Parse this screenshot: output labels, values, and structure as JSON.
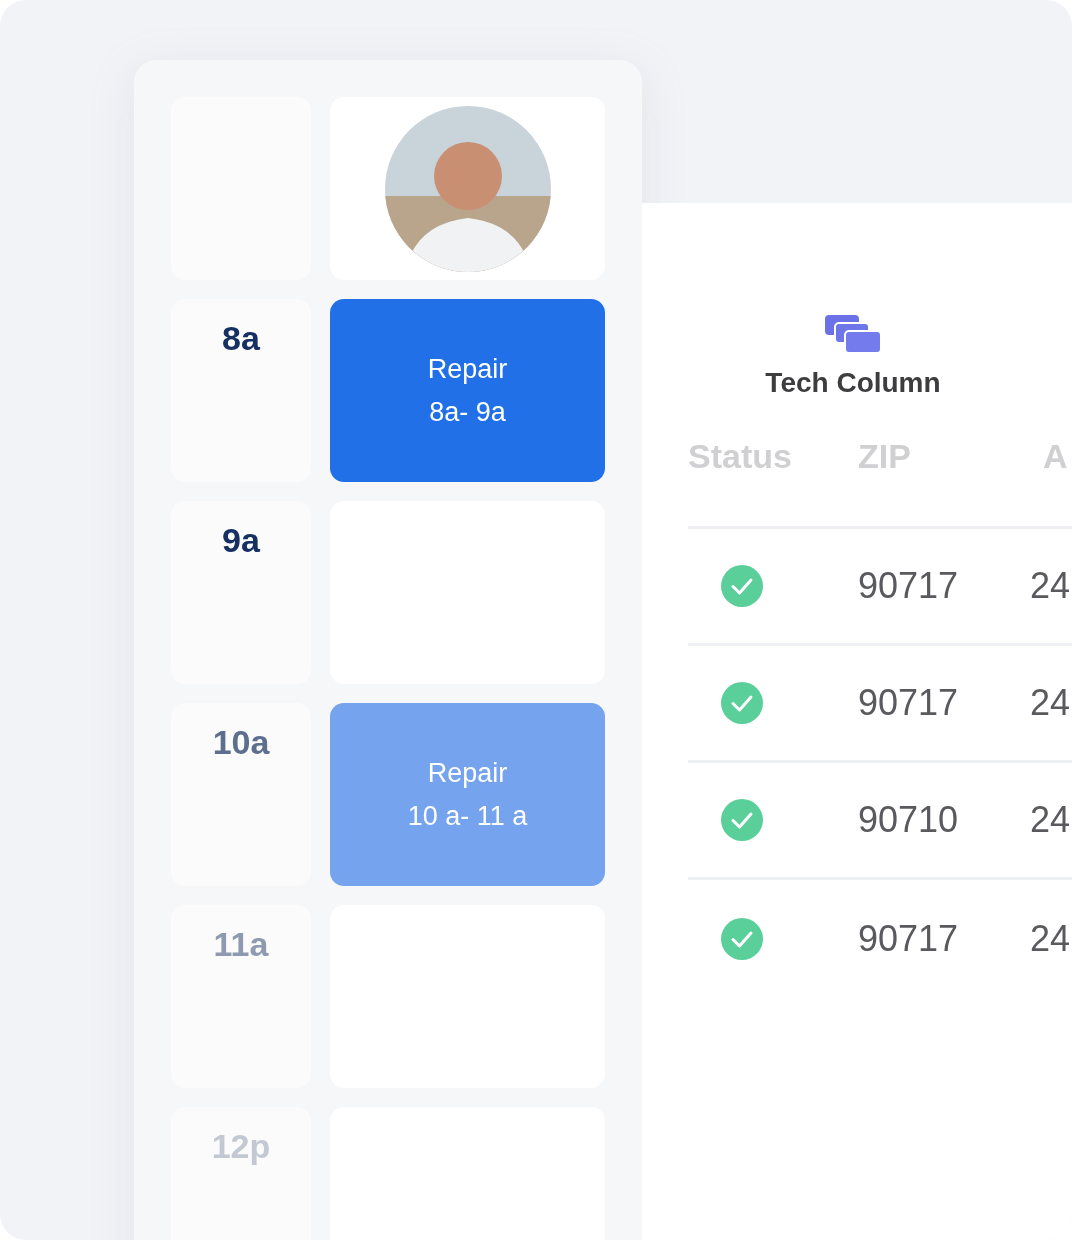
{
  "schedule": {
    "slots": [
      {
        "time": "8a",
        "event": {
          "title": "Repair",
          "range": "8a-  9a",
          "color": "#2170e8"
        }
      },
      {
        "time": "9a"
      },
      {
        "time": "10a",
        "event": {
          "title": "Repair",
          "range": "10 a-  11 a",
          "color": "#75a3ed"
        }
      },
      {
        "time": "11a"
      },
      {
        "time": "12p"
      }
    ]
  },
  "tech_column": {
    "title": "Tech Column",
    "table": {
      "columns": [
        "Status",
        "ZIP",
        "A"
      ],
      "rows": [
        {
          "done": true,
          "zip": "90717",
          "column_3": "24"
        },
        {
          "done": true,
          "zip": "90717",
          "column_3": "24"
        },
        {
          "done": true,
          "zip": "90710",
          "column_3": "24"
        },
        {
          "done": true,
          "zip": "90717",
          "column_3": "24"
        }
      ]
    }
  }
}
